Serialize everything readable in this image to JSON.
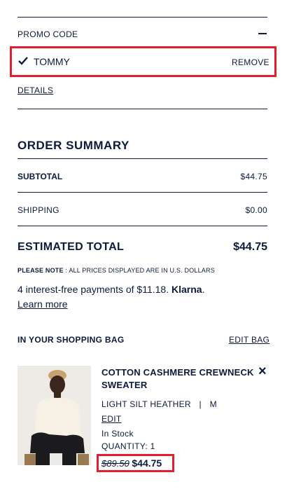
{
  "promo": {
    "heading": "PROMO CODE",
    "toggle": "–",
    "applied_code": "TOMMY",
    "remove_label": "REMOVE",
    "details_label": "DETAILS"
  },
  "summary": {
    "title": "ORDER SUMMARY",
    "subtotal_label": "SUBTOTAL",
    "subtotal_value": "$44.75",
    "shipping_label": "SHIPPING",
    "shipping_value": "$0.00",
    "total_label": "ESTIMATED TOTAL",
    "total_value": "$44.75",
    "note_prefix": "PLEASE NOTE",
    "note_text": " : ALL PRICES DISPLAYED ARE IN U.S. DOLLARS",
    "klarna_text": "4 interest-free payments of $11.18.",
    "klarna_brand": "Klarna",
    "klarna_period": ".",
    "learn_more": "Learn more"
  },
  "bag": {
    "title": "IN YOUR SHOPPING BAG",
    "edit_bag_label": "EDIT BAG",
    "item": {
      "name_line1": "COTTON CASHMERE CREWNECK",
      "name_line2": "SWEATER",
      "close": "×",
      "color": "LIGHT SILT HEATHER",
      "separator": "|",
      "size": "M",
      "edit_label": "EDIT",
      "stock": "In Stock",
      "quantity": "QUANTITY: 1",
      "old_price": "$89.50",
      "new_price": "$44.75"
    }
  },
  "colors": {
    "navy": "#0c1a3c",
    "highlight_red": "#e0202e"
  }
}
